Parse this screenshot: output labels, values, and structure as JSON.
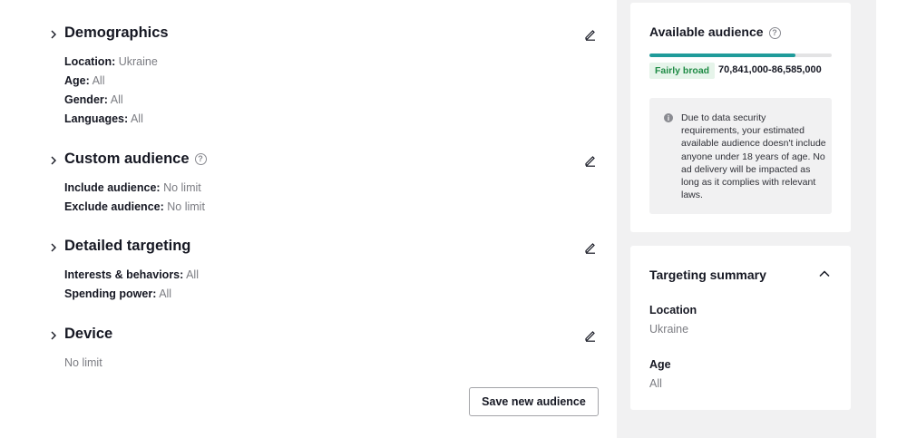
{
  "sections": [
    {
      "title": "Demographics",
      "has_help": false,
      "rows": [
        {
          "label": "Location:",
          "value": "Ukraine"
        },
        {
          "label": "Age:",
          "value": "All"
        },
        {
          "label": "Gender:",
          "value": "All"
        },
        {
          "label": "Languages:",
          "value": "All"
        }
      ]
    },
    {
      "title": "Custom audience",
      "has_help": true,
      "rows": [
        {
          "label": "Include audience:",
          "value": "No limit"
        },
        {
          "label": "Exclude audience:",
          "value": "No limit"
        }
      ]
    },
    {
      "title": "Detailed targeting",
      "has_help": false,
      "rows": [
        {
          "label": "Interests & behaviors:",
          "value": "All"
        },
        {
          "label": "Spending power:",
          "value": "All"
        }
      ]
    },
    {
      "title": "Device",
      "has_help": false,
      "rows": [
        {
          "label": "",
          "value": "No limit"
        }
      ]
    }
  ],
  "save_button_label": "Save new audience",
  "audience_card": {
    "title": "Available audience",
    "breadth_fraction": 0.8,
    "badge": "Fairly broad",
    "range": "70,841,000-86,585,000",
    "notice": "Due to data security requirements, your estimated available audience doesn't include anyone under 18 years of age. No ad delivery will be impacted as long as it complies with relevant laws."
  },
  "summary_card": {
    "title": "Targeting summary",
    "items": [
      {
        "label": "Location",
        "value": "Ukraine"
      },
      {
        "label": "Age",
        "value": "All"
      }
    ]
  },
  "colors": {
    "accent_teal": "#1f9b9a",
    "badge_bg": "#e6f4ea",
    "badge_text": "#1f8b45",
    "panel_bg": "#f1f1f2"
  },
  "icons": {
    "section_toggle": "chevron-right-icon",
    "edit": "pencil-icon",
    "help": "question-circle-icon",
    "info": "info-circle-icon",
    "collapse": "chevron-up-icon"
  }
}
